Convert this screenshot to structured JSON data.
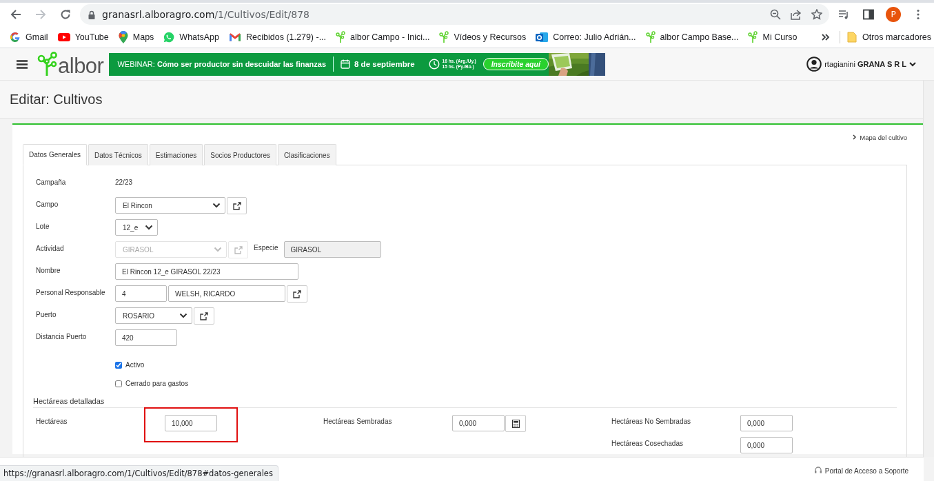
{
  "browser": {
    "url_host": "granasrl.alboragro.com",
    "url_path": "/1/Cultivos/Edit/878",
    "profile_initial": "P",
    "bookmarks": [
      {
        "label": "Gmail",
        "kind": "google"
      },
      {
        "label": "YouTube",
        "kind": "youtube"
      },
      {
        "label": "Maps",
        "kind": "maps"
      },
      {
        "label": "WhatsApp",
        "kind": "whatsapp"
      },
      {
        "label": "Recibidos (1.279) -...",
        "kind": "gmail"
      },
      {
        "label": "albor Campo - Inici...",
        "kind": "albor"
      },
      {
        "label": "Vídeos y Recursos",
        "kind": "albor"
      },
      {
        "label": "Correo: Julio Adrián...",
        "kind": "outlook"
      },
      {
        "label": "albor Campo Base...",
        "kind": "albor"
      },
      {
        "label": "Mi Curso",
        "kind": "albor"
      }
    ],
    "other_bookmarks": "Otros marcadores"
  },
  "header": {
    "logo": "albor",
    "banner": {
      "prefix": "WEBINAR:",
      "headline": "Cómo ser productor sin descuidar las finanzas",
      "date": "8 de septiembre",
      "times": [
        "16 hs. (Arg./Uy.)",
        "15 hs. (Py./Bo.)"
      ],
      "cta": "Inscribite aquí"
    },
    "user": "rtagianini",
    "company": "GRANA S R L"
  },
  "page_title": "Editar: Cultivos",
  "map_link": "Mapa del cultivo",
  "tabs": [
    {
      "label": "Datos Generales",
      "selected": true
    },
    {
      "label": "Datos Técnicos",
      "selected": false
    },
    {
      "label": "Estimaciones",
      "selected": false
    },
    {
      "label": "Socios Productores",
      "selected": false
    },
    {
      "label": "Clasificaciones",
      "selected": false
    }
  ],
  "rows": [
    {
      "label": "Campaña",
      "controls": [
        {
          "kind": "text",
          "value": "22/23"
        }
      ]
    },
    {
      "label": "Campo",
      "controls": [
        {
          "kind": "select",
          "value": "El Rincon",
          "disabled": false
        },
        {
          "kind": "link",
          "disabled": false
        }
      ]
    },
    {
      "label": "Lote",
      "controls": [
        {
          "kind": "select",
          "value": "12_e",
          "disabled": false
        }
      ]
    },
    {
      "label": "Actividad",
      "controls": [
        {
          "kind": "select",
          "value": "GIRASOL",
          "disabled": true
        },
        {
          "kind": "link",
          "disabled": true
        },
        {
          "kind": "label",
          "value": "Especie"
        },
        {
          "kind": "input",
          "value": "GIRASOL",
          "readonly": true
        }
      ]
    },
    {
      "label": "Nombre",
      "controls": [
        {
          "kind": "input",
          "value": "El Rincon 12_e GIRASOL 22/23",
          "readonly": false
        }
      ]
    },
    {
      "label": "Personal Responsable",
      "controls": [
        {
          "kind": "input",
          "value": "4",
          "readonly": false
        },
        {
          "kind": "input",
          "value": "WELSH, RICARDO",
          "readonly": false
        },
        {
          "kind": "link",
          "disabled": false
        }
      ]
    },
    {
      "label": "Puerto",
      "controls": [
        {
          "kind": "select",
          "value": "ROSARIO",
          "disabled": false
        },
        {
          "kind": "link",
          "disabled": false
        }
      ]
    },
    {
      "label": "Distancia Puerto",
      "controls": [
        {
          "kind": "input",
          "value": "420",
          "readonly": false
        }
      ]
    }
  ],
  "checkboxes": [
    {
      "label": "Activo",
      "checked": true
    },
    {
      "label": "Cerrado para gastos",
      "checked": false
    }
  ],
  "hectares": {
    "title": "Hectáreas detalladas",
    "fields": [
      {
        "label": "Hectáreas",
        "value": "10,000",
        "highlighted": true,
        "calculator": false
      },
      {
        "label": "Hectáreas Sembradas",
        "value": "0,000",
        "highlighted": false,
        "calculator": true
      },
      {
        "label": "Hectáreas No Sembradas",
        "value": "0,000",
        "highlighted": false,
        "calculator": false
      },
      {
        "label": "Hectáreas Cosechadas",
        "value": "0,000",
        "highlighted": false,
        "calculator": false
      }
    ]
  },
  "footer": {
    "support": "Portal de Acceso a Soporte"
  },
  "status_url": "https://granasrl.alboragro.com/1/Cultivos/Edit/878#datos-generales"
}
